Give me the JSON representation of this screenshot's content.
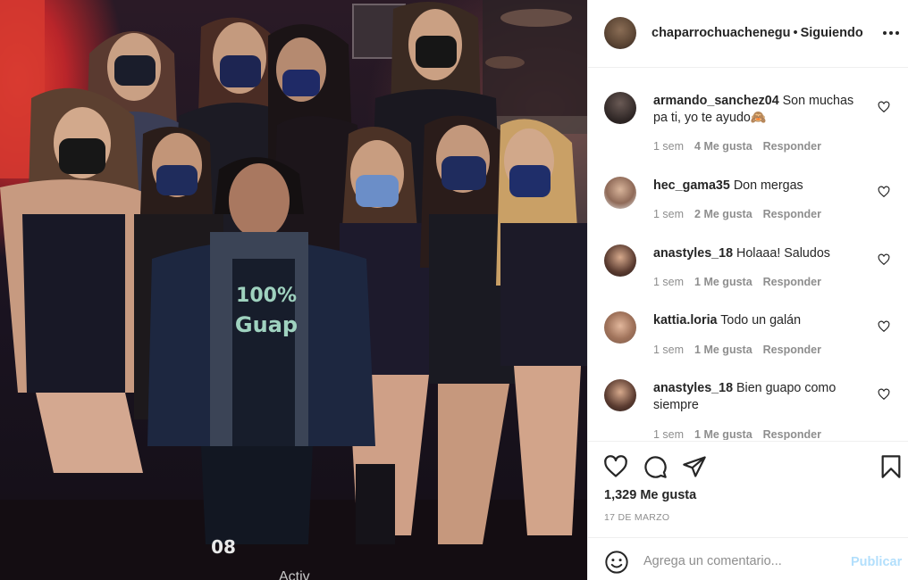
{
  "photo": {
    "shirt_text_line1": "100%",
    "shirt_text_line2": "Guap",
    "shorts_text": "08"
  },
  "header": {
    "username": "chaparrochuachenegu",
    "separator": "•",
    "follow_status": "Siguiendo"
  },
  "comments": [
    {
      "username": "armando_sanchez04",
      "text": "Son muchas pa ti, yo te ayudo🙈",
      "time": "1 sem",
      "likes": "4 Me gusta",
      "reply": "Responder"
    },
    {
      "username": "hec_gama35",
      "text": "Don mergas",
      "time": "1 sem",
      "likes": "2 Me gusta",
      "reply": "Responder"
    },
    {
      "username": "anastyles_18",
      "text": "Holaaa! Saludos",
      "time": "1 sem",
      "likes": "1 Me gusta",
      "reply": "Responder"
    },
    {
      "username": "kattia.loria",
      "text": "Todo un galán",
      "time": "1 sem",
      "likes": "1 Me gusta",
      "reply": "Responder"
    },
    {
      "username": "anastyles_18",
      "text": "Bien guapo como siempre",
      "time": "1 sem",
      "likes": "1 Me gusta",
      "reply": "Responder"
    }
  ],
  "post": {
    "likes": "1,329 Me gusta",
    "date": "17 DE MARZO"
  },
  "add_comment": {
    "placeholder": "Agrega un comentario...",
    "post_label": "Publicar"
  },
  "overlay": {
    "watermark": "Activ"
  },
  "icons": {
    "like": "heart-icon",
    "comment": "comment-icon",
    "share": "share-icon",
    "save": "bookmark-icon",
    "emoji": "emoji-icon",
    "more": "more-icon"
  },
  "colors": {
    "post_button": "#b2dffc",
    "meta_text": "#8e8e8e",
    "border": "#efefef"
  }
}
